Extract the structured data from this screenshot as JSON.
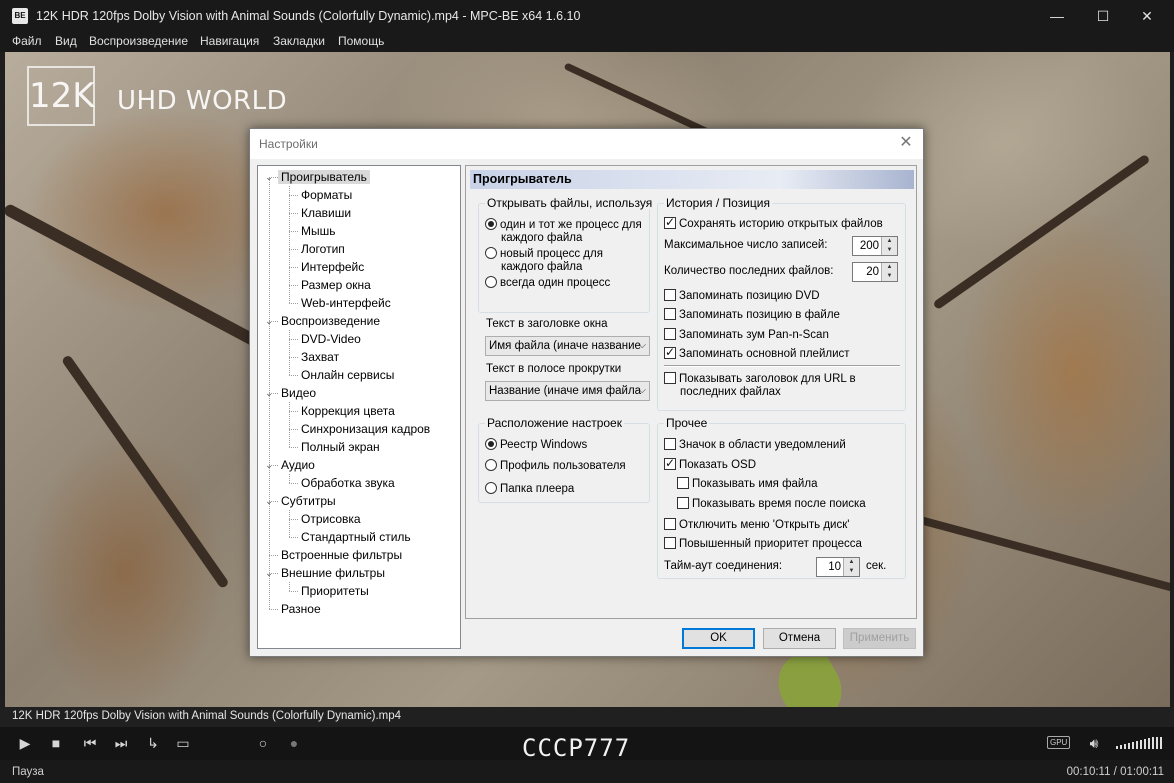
{
  "window": {
    "title": "12K HDR 120fps Dolby Vision with Animal Sounds (Colorfully Dynamic).mp4 - MPC-BE x64 1.6.10",
    "app_icon_text": "BE",
    "minimize": "—",
    "maximize": "☐",
    "close": "✕"
  },
  "menu": [
    "Файл",
    "Вид",
    "Воспроизведение",
    "Навигация",
    "Закладки",
    "Помощь"
  ],
  "video": {
    "logo_mark": "12K",
    "logo_text": "UHD WORLD"
  },
  "dialog": {
    "title": "Настройки",
    "close": "✕",
    "tree": [
      {
        "label": "Проигрыватель",
        "level": 0,
        "expanded": true,
        "selected": true
      },
      {
        "label": "Форматы",
        "level": 1
      },
      {
        "label": "Клавиши",
        "level": 1
      },
      {
        "label": "Мышь",
        "level": 1
      },
      {
        "label": "Логотип",
        "level": 1
      },
      {
        "label": "Интерфейс",
        "level": 1
      },
      {
        "label": "Размер окна",
        "level": 1
      },
      {
        "label": "Web-интерфейс",
        "level": 1
      },
      {
        "label": "Воспроизведение",
        "level": 0,
        "expanded": true
      },
      {
        "label": "DVD-Video",
        "level": 1
      },
      {
        "label": "Захват",
        "level": 1
      },
      {
        "label": "Онлайн сервисы",
        "level": 1
      },
      {
        "label": "Видео",
        "level": 0,
        "expanded": true
      },
      {
        "label": "Коррекция цвета",
        "level": 1
      },
      {
        "label": "Синхронизация кадров",
        "level": 1
      },
      {
        "label": "Полный экран",
        "level": 1
      },
      {
        "label": "Аудио",
        "level": 0,
        "expanded": true
      },
      {
        "label": "Обработка звука",
        "level": 1
      },
      {
        "label": "Субтитры",
        "level": 0,
        "expanded": true
      },
      {
        "label": "Отрисовка",
        "level": 1
      },
      {
        "label": "Стандартный стиль",
        "level": 1
      },
      {
        "label": "Встроенные фильтры",
        "level": 0
      },
      {
        "label": "Внешние фильтры",
        "level": 0,
        "expanded": true
      },
      {
        "label": "Приоритеты",
        "level": 1
      },
      {
        "label": "Разное",
        "level": 0
      }
    ],
    "page": {
      "header": "Проигрыватель",
      "open_files": {
        "title": "Открывать файлы, используя",
        "options": [
          {
            "line1": "один и тот же процесс для",
            "line2": "каждого файла",
            "checked": true
          },
          {
            "line1": "новый процесс для",
            "line2": "каждого файла",
            "checked": false
          },
          {
            "line1": "всегда один процесс",
            "line2": "",
            "checked": false
          }
        ]
      },
      "window_title_label": "Текст в заголовке окна",
      "window_title_value": "Имя файла (иначе название",
      "seekbar_label": "Текст в полосе прокрутки",
      "seekbar_value": "Название (иначе имя файла",
      "settings_location": {
        "title": "Расположение настроек",
        "options": [
          {
            "label": "Реестр Windows",
            "checked": true
          },
          {
            "label": "Профиль пользователя",
            "checked": false
          },
          {
            "label": "Папка плеера",
            "checked": false
          }
        ]
      },
      "history": {
        "title": "История / Позиция",
        "keep_history": {
          "label": "Сохранять историю открытых файлов",
          "checked": true
        },
        "max_records_label": "Максимальное число записей:",
        "max_records_value": "200",
        "recent_files_label": "Количество последних файлов:",
        "recent_files_value": "20",
        "checks": [
          {
            "label": "Запоминать позицию DVD",
            "checked": false
          },
          {
            "label": "Запоминать позицию в файле",
            "checked": false
          },
          {
            "label": "Запоминать зум Pan-n-Scan",
            "checked": false
          },
          {
            "label": "Запоминать основной плейлист",
            "checked": true
          }
        ],
        "url_titles": {
          "line1": "Показывать заголовок для URL в",
          "line2": "последних файлах",
          "checked": false
        }
      },
      "other": {
        "title": "Прочее",
        "checks": [
          {
            "label": "Значок в области уведомлений",
            "checked": false,
            "indent": false
          },
          {
            "label": "Показать OSD",
            "checked": true,
            "indent": false
          },
          {
            "label": "Показывать имя файла",
            "checked": false,
            "indent": true
          },
          {
            "label": "Показывать время после поиска",
            "checked": false,
            "indent": true
          },
          {
            "label": "Отключить меню 'Открыть диск'",
            "checked": false,
            "indent": false
          },
          {
            "label": "Повышенный приоритет процесса",
            "checked": false,
            "indent": false
          }
        ],
        "timeout_label": "Тайм-аут соединения:",
        "timeout_value": "10",
        "timeout_unit": "сек."
      }
    },
    "buttons": {
      "ok": "OK",
      "cancel": "Отмена",
      "apply": "Применить"
    }
  },
  "player": {
    "filename": "12K HDR 120fps Dolby Vision with Animal Sounds (Colorfully Dynamic).mp4",
    "osd_text": "CCCP777",
    "gpu_badge": "GPU",
    "volume_level": 1.0,
    "status": "Пауза",
    "time": "00:10:11 / 01:00:11",
    "icons": [
      "play-icon",
      "stop-icon",
      "previous-icon",
      "next-icon",
      "frame-step-icon",
      "subtitle-icon",
      "search-icon",
      "chat-icon",
      "volume-icon"
    ]
  }
}
